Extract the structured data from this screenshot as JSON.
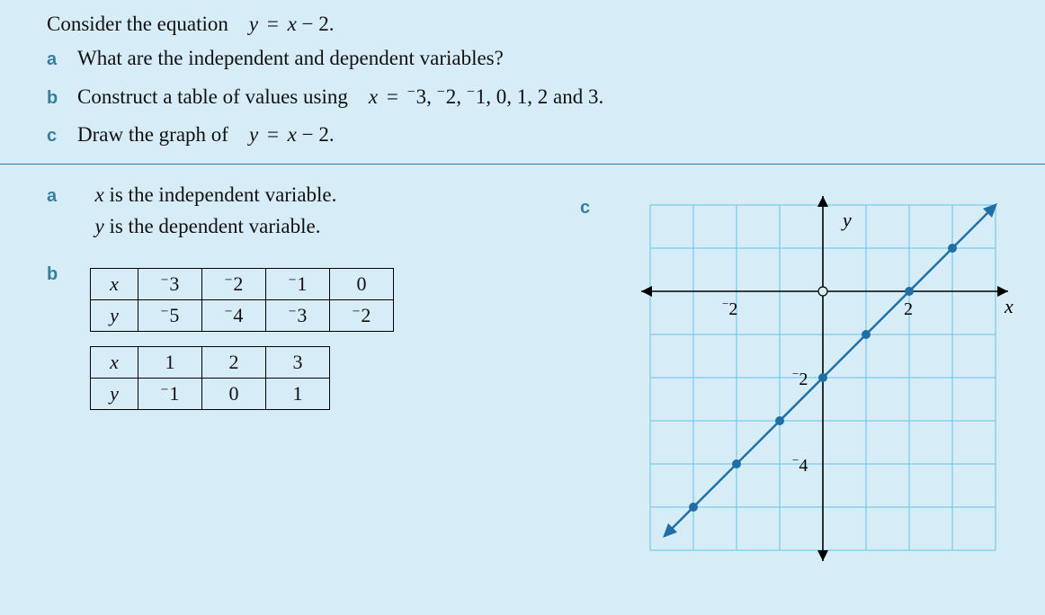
{
  "question": {
    "intro_pre": "Consider the equation",
    "intro_eq_lhs": "y",
    "intro_eq_rhs": "x − 2.",
    "parts": {
      "a": {
        "label": "a",
        "text": "What are the independent and dependent variables?"
      },
      "b": {
        "label": "b",
        "pre": "Construct a table of values using",
        "var": "x",
        "eq": "=",
        "vals": "⁻3, ⁻2, ⁻1, 0, 1, 2 and 3."
      },
      "c": {
        "label": "c",
        "pre": "Draw the graph of",
        "eq_lhs": "y",
        "eq_rhs": "x − 2."
      }
    }
  },
  "answers": {
    "a": {
      "label": "a",
      "line1_var": "x",
      "line1_rest": " is the independent variable.",
      "line2_var": "y",
      "line2_rest": " is the dependent variable."
    },
    "b": {
      "label": "b",
      "table1": {
        "row_x_label": "x",
        "row_y_label": "y",
        "x": [
          "⁻3",
          "⁻2",
          "⁻1",
          "0"
        ],
        "y": [
          "⁻5",
          "⁻4",
          "⁻3",
          "⁻2"
        ]
      },
      "table2": {
        "row_x_label": "x",
        "row_y_label": "y",
        "x": [
          "1",
          "2",
          "3"
        ],
        "y": [
          "⁻1",
          "0",
          "1"
        ]
      }
    },
    "c": {
      "label": "c"
    }
  },
  "chart_data": {
    "type": "line",
    "title": "",
    "xlabel": "x",
    "ylabel": "y",
    "xlim": [
      -4,
      4
    ],
    "ylim": [
      -6,
      2
    ],
    "xticks_labeled": [
      -2,
      2
    ],
    "yticks_labeled": [
      -2,
      -4
    ],
    "series": [
      {
        "name": "y = x − 2",
        "x": [
          -3,
          -2,
          -1,
          0,
          1,
          2,
          3
        ],
        "y": [
          -5,
          -4,
          -3,
          -2,
          -1,
          0,
          1
        ]
      }
    ],
    "grid": true
  },
  "graph_labels": {
    "y": "y",
    "x": "x",
    "neg2": "2",
    "pos2": "2",
    "yneg2": "2",
    "yneg4": "4",
    "neg_glyph": "−"
  }
}
